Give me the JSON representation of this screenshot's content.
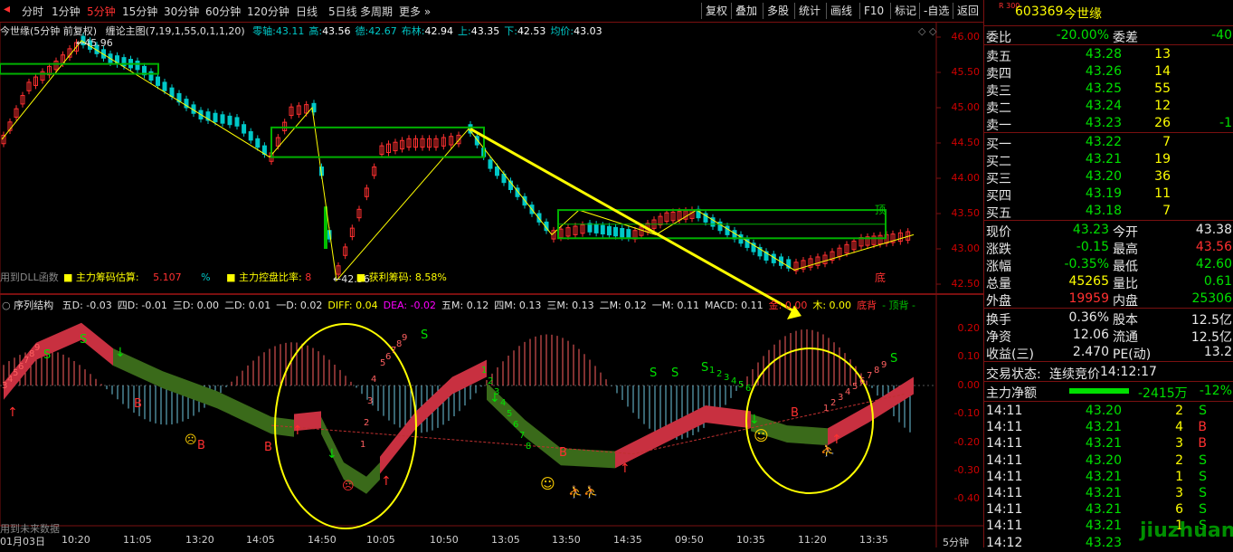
{
  "toolbar": {
    "periods": [
      "分时",
      "1分钟",
      "5分钟",
      "15分钟",
      "30分钟",
      "60分钟",
      "120分钟",
      "日线",
      "5日线",
      "多周期",
      "更多"
    ],
    "active_period": "5分钟",
    "right_buttons": [
      "复权",
      "叠加",
      "多股",
      "统计",
      "画线",
      "F10",
      "标记",
      "-自选",
      "返回"
    ]
  },
  "main_legend": {
    "stock": "今世缘(5分钟 前复权)",
    "indicator": "缠论主图(7,19,1,55,0,1,1,20)",
    "items": [
      {
        "label": "零轴:",
        "value": "43.11",
        "color": "#00c8c8"
      },
      {
        "label": "高:",
        "value": "43.56",
        "color": "#ffffff"
      },
      {
        "label": "德:",
        "value": "42.67",
        "color": "#00c8c8"
      },
      {
        "label": "布林:",
        "value": "42.94",
        "color": "#ffffff"
      },
      {
        "label": "上:",
        "value": "43.35",
        "color": "#ffffff"
      },
      {
        "label": "下:",
        "value": "42.53",
        "color": "#ffffff"
      },
      {
        "label": "均价:",
        "value": "43.03",
        "color": "#ffffff"
      }
    ]
  },
  "main_axis": [
    "46.00",
    "45.50",
    "45.00",
    "44.50",
    "44.00",
    "43.50",
    "43.00",
    "42.50"
  ],
  "main_annotations": {
    "high_label": "45.96",
    "low_label": "42.56",
    "top_mark": "顶",
    "bottom_mark": "底",
    "dll_text": "用到DLL函数",
    "chip_est_label": "主力筹码估算:",
    "chip_est_value": "5.107",
    "chip_est_unit": "%",
    "control_label": "主力控盘比率:",
    "control_value": "8",
    "profit_label": "获利筹码:",
    "profit_value": "8.58%"
  },
  "sub_legend": {
    "title": "序列结构",
    "items": [
      {
        "text": "五D: -0.03",
        "color": "#e0e0e0"
      },
      {
        "text": "四D: -0.01",
        "color": "#e0e0e0"
      },
      {
        "text": "三D: 0.00",
        "color": "#e0e0e0"
      },
      {
        "text": "二D: 0.01",
        "color": "#e0e0e0"
      },
      {
        "text": "一D: 0.02",
        "color": "#e0e0e0"
      },
      {
        "text": "DIFF: 0.04",
        "color": "#ffff00"
      },
      {
        "text": "DEA: -0.02",
        "color": "#ff00ff"
      },
      {
        "text": "五M: 0.12",
        "color": "#e0e0e0"
      },
      {
        "text": "四M: 0.13",
        "color": "#e0e0e0"
      },
      {
        "text": "三M: 0.13",
        "color": "#e0e0e0"
      },
      {
        "text": "二M: 0.12",
        "color": "#e0e0e0"
      },
      {
        "text": "一M: 0.11",
        "color": "#e0e0e0"
      },
      {
        "text": "MACD: 0.11",
        "color": "#e0e0e0"
      },
      {
        "text": "金: 0.00",
        "color": "#ff3030"
      },
      {
        "text": "木: 0.00",
        "color": "#ffff00"
      },
      {
        "text": "底背",
        "color": "#ff3030"
      },
      {
        "text": "- 顶背 -",
        "color": "#00c000"
      }
    ]
  },
  "sub_axis": [
    "0.20",
    "0.10",
    "0.00",
    "-0.10",
    "-0.20",
    "-0.30",
    "-0.40"
  ],
  "sub_annotations": {
    "future_text": "用到未来数据",
    "period_label": "5分钟"
  },
  "x_axis": [
    "01月03日",
    "10:20",
    "11:05",
    "13:20",
    "14:05",
    "14:50",
    "10:05",
    "10:50",
    "13:05",
    "13:50",
    "14:35",
    "09:50",
    "10:35",
    "11:20",
    "13:35"
  ],
  "quote": {
    "market_badge": "R 300",
    "code": "603369",
    "name": "今世缘",
    "weibi_label": "委比",
    "weibi_value": "-20.00%",
    "weicha_label": "委差",
    "weicha_value": "-40",
    "asks": [
      {
        "label": "卖五",
        "price": "43.28",
        "vol": "13",
        "delta": ""
      },
      {
        "label": "卖四",
        "price": "43.26",
        "vol": "14",
        "delta": ""
      },
      {
        "label": "卖三",
        "price": "43.25",
        "vol": "55",
        "delta": ""
      },
      {
        "label": "卖二",
        "price": "43.24",
        "vol": "12",
        "delta": ""
      },
      {
        "label": "卖一",
        "price": "43.23",
        "vol": "26",
        "delta": "-1"
      }
    ],
    "bids": [
      {
        "label": "买一",
        "price": "43.22",
        "vol": "7"
      },
      {
        "label": "买二",
        "price": "43.21",
        "vol": "19"
      },
      {
        "label": "买三",
        "price": "43.20",
        "vol": "36"
      },
      {
        "label": "买四",
        "price": "43.19",
        "vol": "11"
      },
      {
        "label": "买五",
        "price": "43.18",
        "vol": "7"
      }
    ],
    "stats": [
      {
        "l1": "现价",
        "v1": "43.23",
        "c1": "green",
        "l2": "今开",
        "v2": "43.38",
        "c2": "white"
      },
      {
        "l1": "涨跌",
        "v1": "-0.15",
        "c1": "green",
        "l2": "最高",
        "v2": "43.56",
        "c2": "red"
      },
      {
        "l1": "涨幅",
        "v1": "-0.35%",
        "c1": "green",
        "l2": "最低",
        "v2": "42.60",
        "c2": "green"
      },
      {
        "l1": "总量",
        "v1": "45265",
        "c1": "yellow",
        "l2": "量比",
        "v2": "0.61",
        "c2": "green"
      },
      {
        "l1": "外盘",
        "v1": "19959",
        "c1": "red",
        "l2": "内盘",
        "v2": "25306",
        "c2": "green"
      }
    ],
    "stats2": [
      {
        "l1": "换手",
        "v1": "0.36%",
        "l2": "股本",
        "v2": "12.5亿"
      },
      {
        "l1": "净资",
        "v1": "12.06",
        "l2": "流通",
        "v2": "12.5亿"
      },
      {
        "l1": "收益(三)",
        "v1": "2.470",
        "l2": "PE(动)",
        "v2": "13.2"
      }
    ],
    "trade_status_label": "交易状态:",
    "trade_status_value": "连续竞价",
    "trade_time": "14:12:17",
    "net_label": "主力净额",
    "net_value": "-2415万",
    "net_pct": "-12%"
  },
  "ticks": [
    {
      "t": "14:11",
      "p": "43.20",
      "v": "2",
      "s": "S"
    },
    {
      "t": "14:11",
      "p": "43.21",
      "v": "4",
      "s": "B"
    },
    {
      "t": "14:11",
      "p": "43.21",
      "v": "3",
      "s": "B"
    },
    {
      "t": "14:11",
      "p": "43.20",
      "v": "2",
      "s": "S"
    },
    {
      "t": "14:11",
      "p": "43.21",
      "v": "1",
      "s": "S"
    },
    {
      "t": "14:11",
      "p": "43.21",
      "v": "3",
      "s": "S"
    },
    {
      "t": "14:11",
      "p": "43.21",
      "v": "6",
      "s": "S"
    },
    {
      "t": "14:11",
      "p": "43.21",
      "v": "1",
      "s": "S"
    },
    {
      "t": "14:12",
      "p": "43.23",
      "v": "",
      "s": ""
    }
  ],
  "watermark": "jiuzhuan.com",
  "colors": {
    "up": "#ff3030",
    "down": "#00c8c8",
    "frame": "#7a1010",
    "ma": "#ffff00",
    "box": "#00b000"
  }
}
